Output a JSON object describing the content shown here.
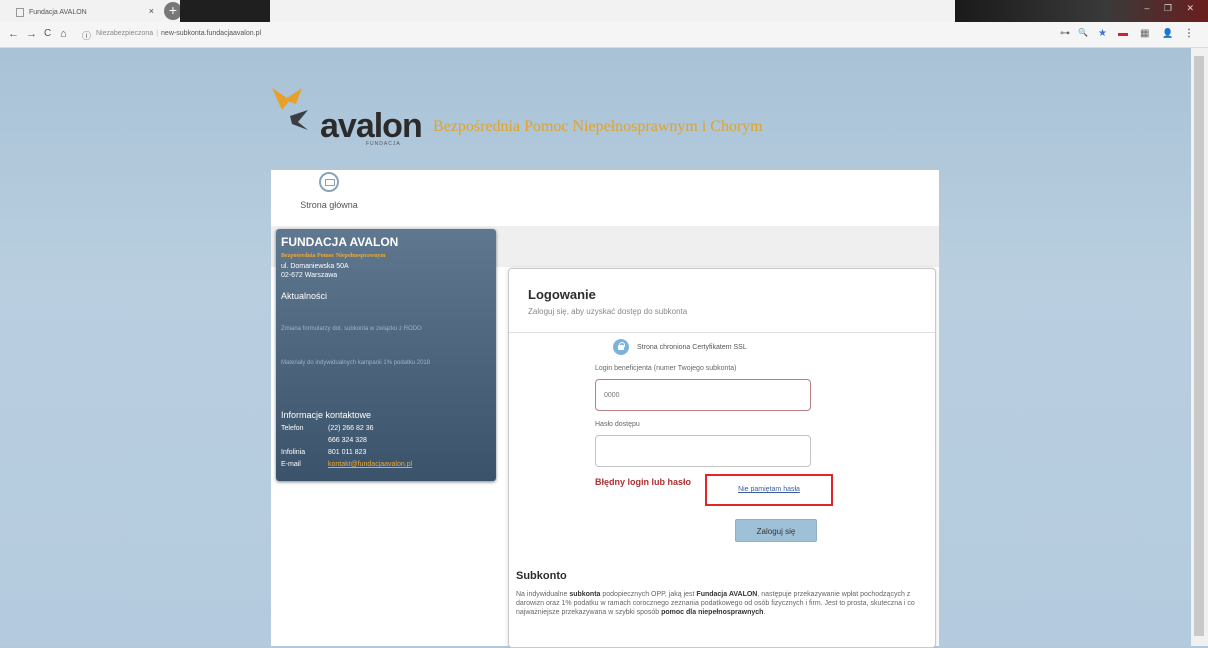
{
  "browser": {
    "tab_title": "Fundacja AVALON",
    "tab_close": "×",
    "new_tab": "+",
    "back": "←",
    "forward": "→",
    "reload": "C",
    "home": "⌂",
    "info": "ⓘ",
    "url_security": "Niezabezpieczona",
    "url_sep": "|",
    "url_host": "new-subkonta.fundacjaavalon.pl",
    "window_controls": "– ❐ ✕",
    "ext_icons": [
      "⊶",
      "🔍",
      "★",
      "▬",
      "▦",
      "👤",
      "⋮"
    ]
  },
  "header": {
    "logo_word": "avalon",
    "logo_fund": "FUNDACJA",
    "tagline": "Bezpośrednia Pomoc Niepełnosprawnym i Chorym"
  },
  "nav": {
    "home_label": "Strona główna"
  },
  "sidebar": {
    "title": "FUNDACJA AVALON",
    "subtitle": "Bezpośrednia Pomoc Niepełnosprawnym",
    "address_line1": "ul. Domaniewska 50A",
    "address_line2": "02-672 Warszawa",
    "news_heading": "Aktualności",
    "news": [
      "Zmiana formularzy dot. subkonta w związku z RODO",
      "Materiały do indywidualnych kampanii 1% podatku 2018"
    ],
    "contact_heading": "Informacje kontaktowe",
    "contact": {
      "phone_label": "Telefon",
      "phone1": "(22) 266 82 36",
      "phone2": "666 324 328",
      "infoline_label": "Infolinia",
      "infoline": "801 011 823",
      "email_label": "E-mail",
      "email": "kontakt@fundacjaavalon.pl"
    }
  },
  "login": {
    "title": "Logowanie",
    "subtitle": "Zaloguj się, aby uzyskać dostęp do subkonta",
    "ssl_text": "Strona chroniona Certyfikatem SSL",
    "login_label": "Login beneficjenta (numer Twojego subkonta)",
    "login_value": "0000",
    "password_label": "Hasło dostępu",
    "password_value": "",
    "error": "Błędny login lub hasło",
    "forgot": "Nie pamiętam hasła",
    "submit": "Zaloguj się"
  },
  "subkonto": {
    "heading": "Subkonto",
    "p1": "Na indywidualne ",
    "b1": "subkonta",
    "p2": " podopiecznych OPP, jaką jest ",
    "b2": "Fundacja AVALON",
    "p3": ", następuje przekazywanie wpłat pochodzących z darowizn oraz 1% podatku w ramach corocznego zeznania podatkowego od osób fizycznych i firm. Jest to prosta, skuteczna i co najważniejsze przekazywana w szybki sposób ",
    "b3": "pomoc dla niepełnosprawnych",
    "p4": "."
  },
  "colors": {
    "accent_orange": "#e0a32c",
    "sidebar_blue": "#3a536b",
    "error_red": "#b03030",
    "highlight_red": "#e0252b",
    "button_blue": "#9fc1d8"
  }
}
